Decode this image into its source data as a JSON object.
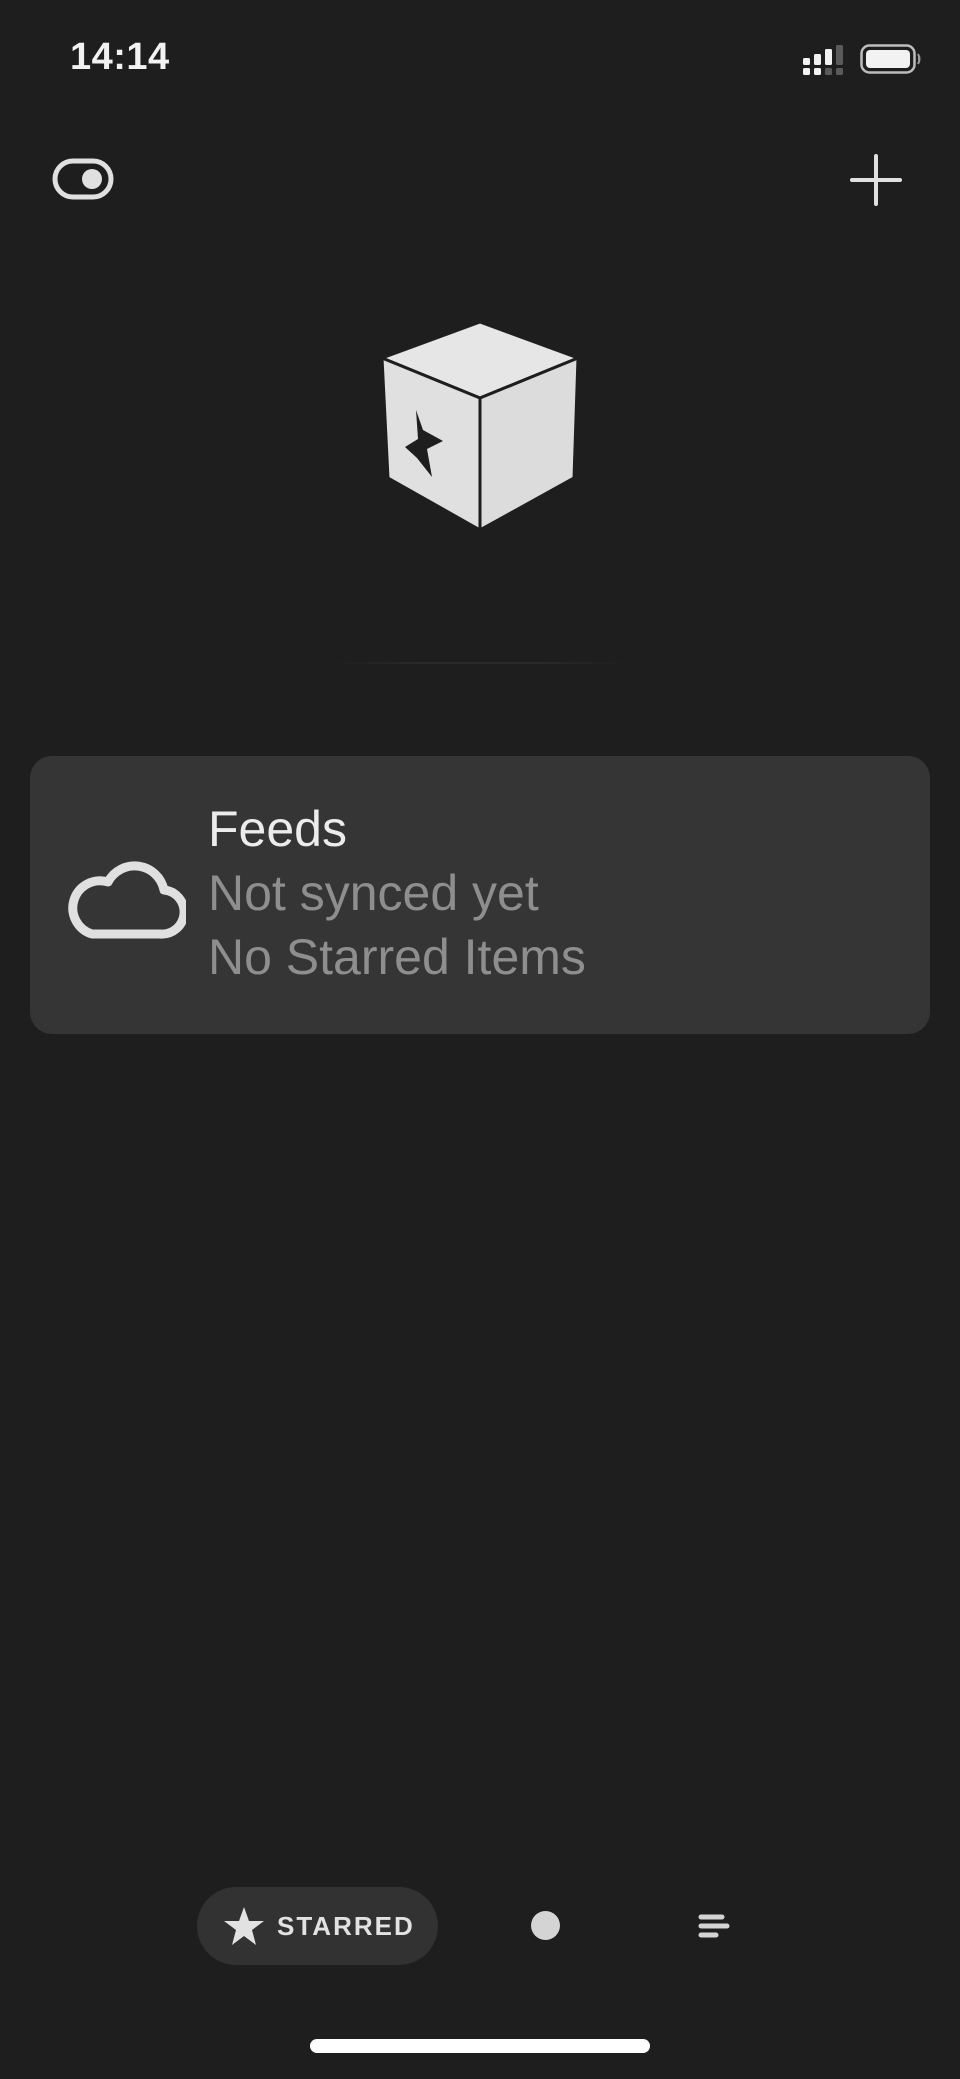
{
  "status_bar": {
    "time": "14:14",
    "signal_icon": "cellular-signal-icon",
    "battery_icon": "battery-icon"
  },
  "toolbar": {
    "left_icon": "toggle-switch-icon",
    "right_icon": "plus-icon"
  },
  "hero": {
    "icon": "star-box-icon"
  },
  "account_card": {
    "icon": "cloud-icon",
    "title": "Feeds",
    "sync_status": "Not synced yet",
    "starred_status": "No Starred Items"
  },
  "tab_bar": {
    "tabs": [
      {
        "label": "STARRED",
        "icon": "star-icon",
        "selected": true
      },
      {
        "label": "",
        "icon": "unread-dot-icon",
        "selected": false
      },
      {
        "label": "",
        "icon": "list-icon",
        "selected": false
      }
    ]
  },
  "colors": {
    "background": "#1e1e1e",
    "card": "#353535",
    "primary_text": "#ececec",
    "secondary_text": "#8e8e8e",
    "icon": "#e0e0e0"
  }
}
